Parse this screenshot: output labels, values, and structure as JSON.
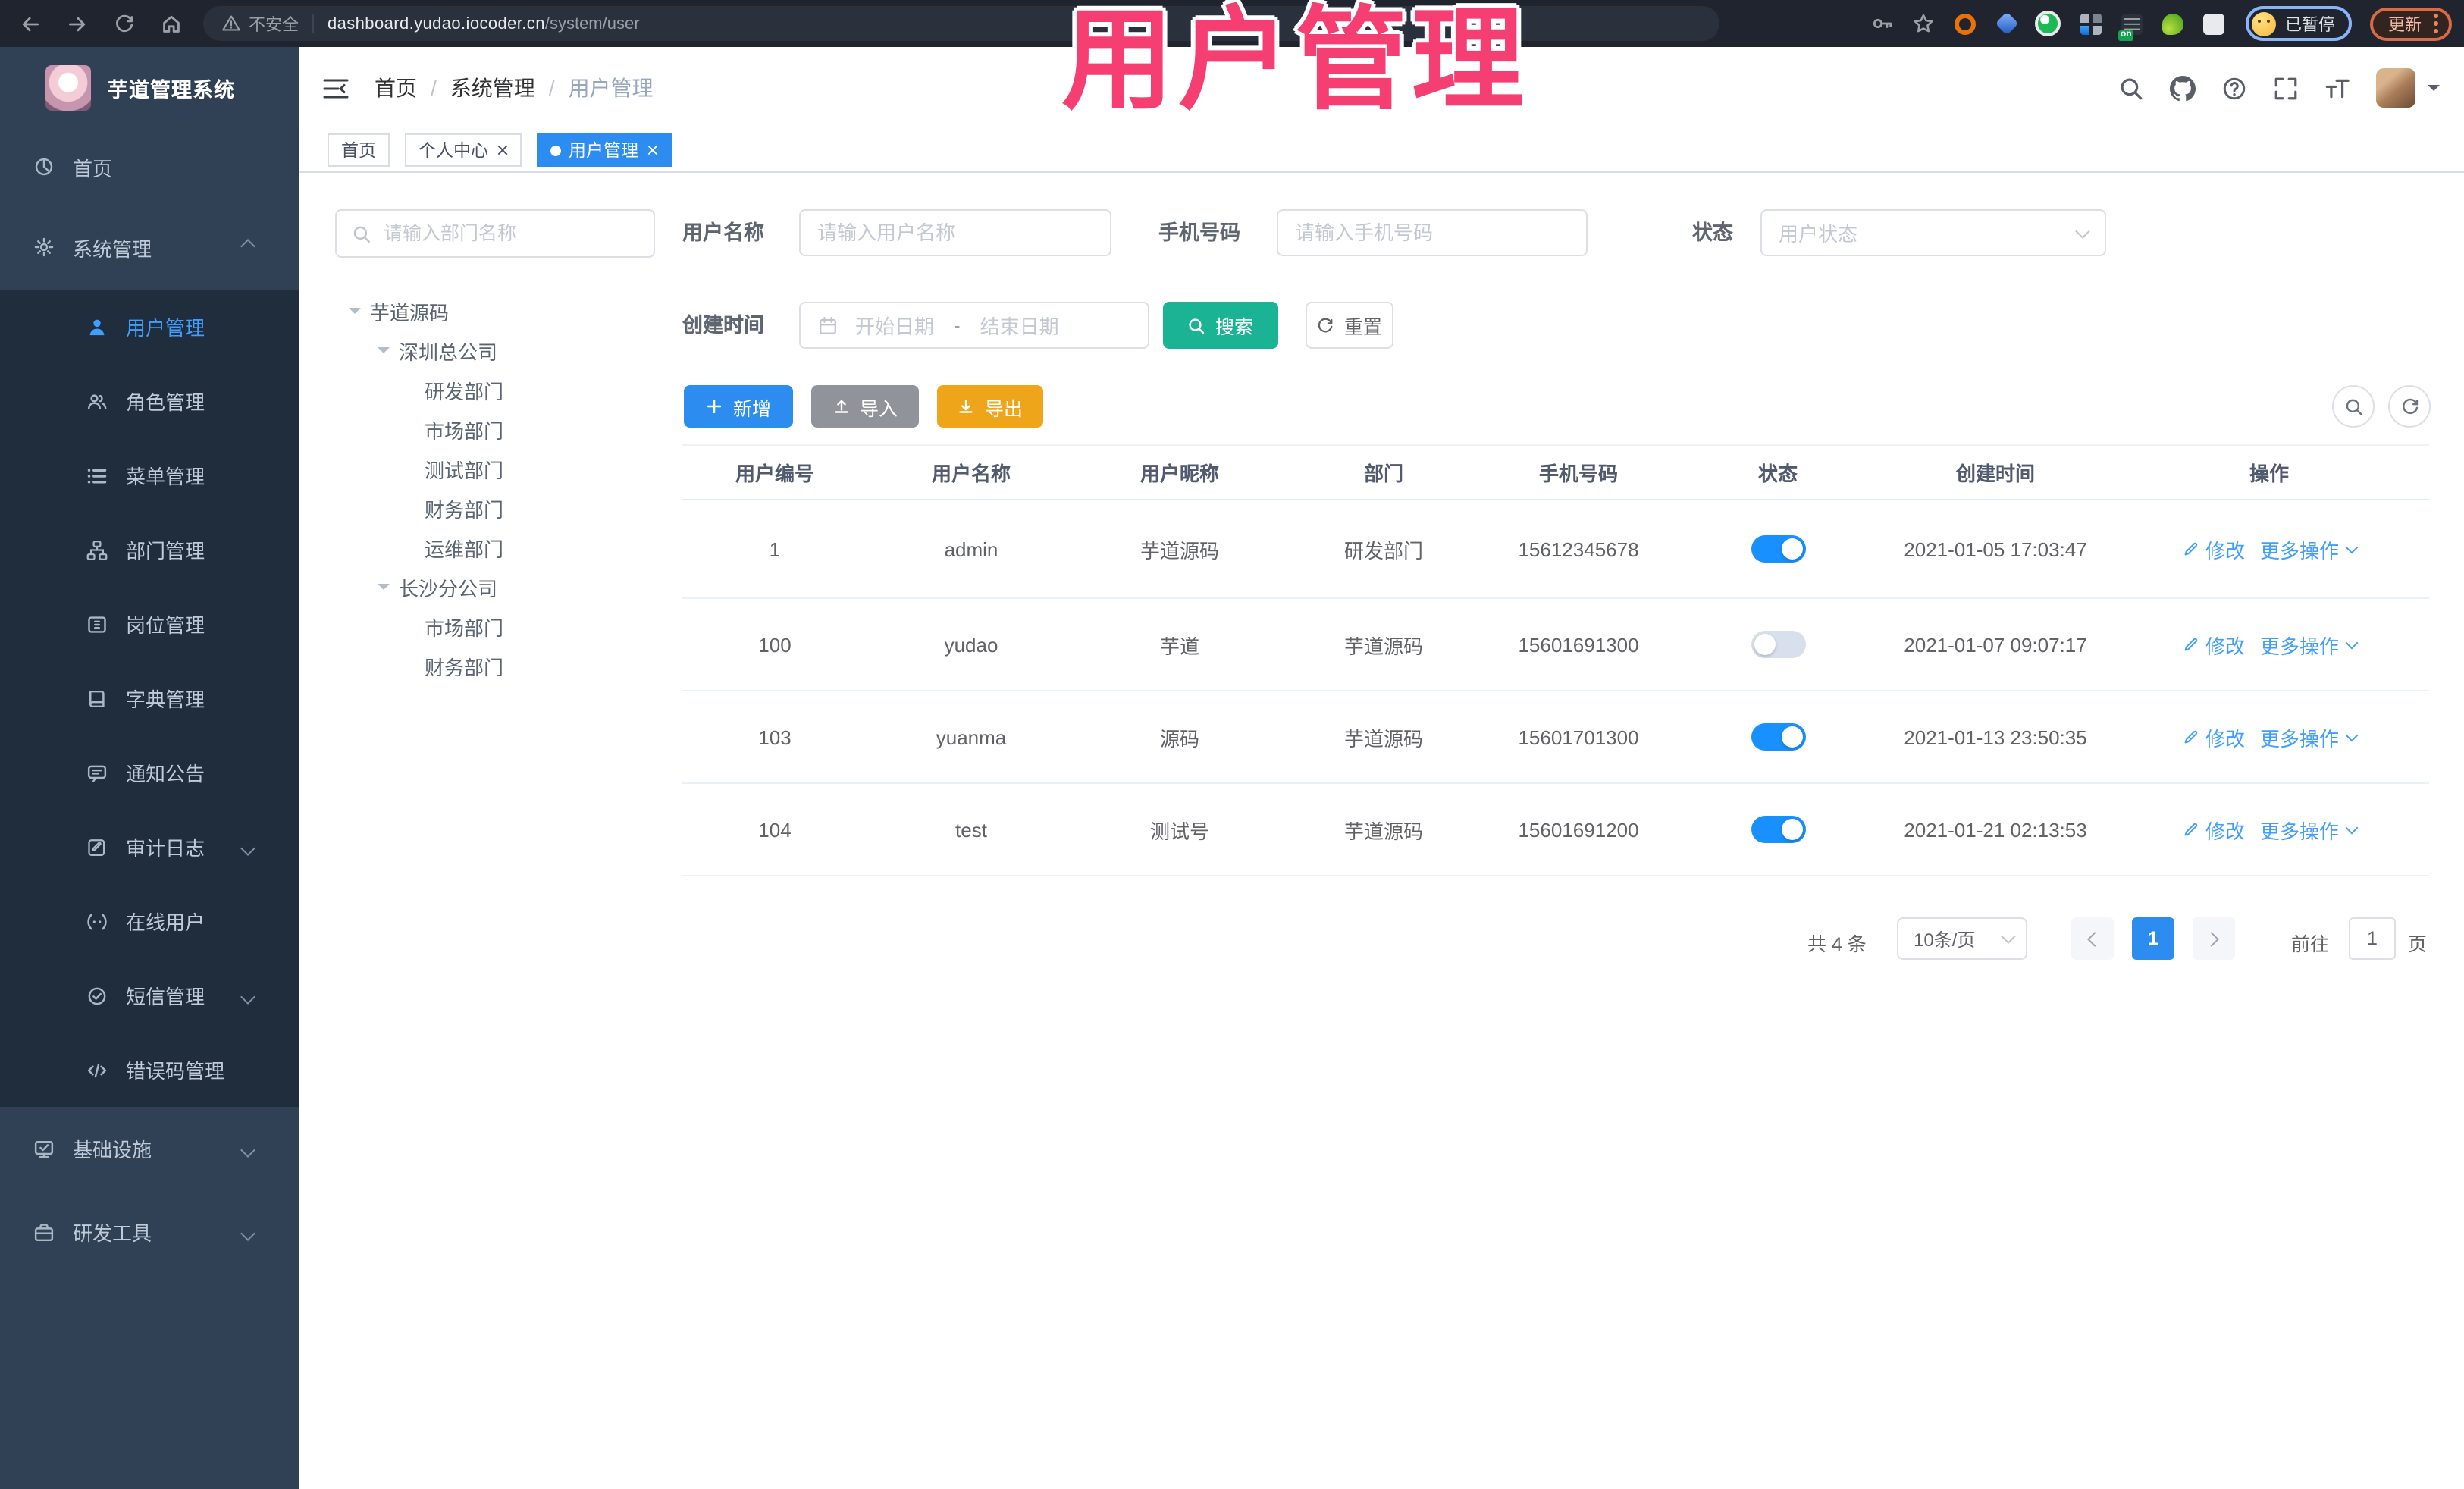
{
  "browser": {
    "security_label": "不安全",
    "url_host": "dashboard.yudao.iocoder.cn",
    "url_path": "/system/user",
    "extension_on_badge": "on",
    "profile_paused_label": "已暂停",
    "update_button_label": "更新"
  },
  "overlay": {
    "watermark": "用户管理"
  },
  "sidebar": {
    "app_title": "芋道管理系统",
    "menu": [
      {
        "label": "首页",
        "icon": "dashboard"
      },
      {
        "label": "系统管理",
        "icon": "gear"
      },
      {
        "label": "用户管理",
        "icon": "user"
      },
      {
        "label": "角色管理",
        "icon": "users"
      },
      {
        "label": "菜单管理",
        "icon": "menu-list"
      },
      {
        "label": "部门管理",
        "icon": "org-tree"
      },
      {
        "label": "岗位管理",
        "icon": "badge"
      },
      {
        "label": "字典管理",
        "icon": "dictionary"
      },
      {
        "label": "通知公告",
        "icon": "announcement"
      },
      {
        "label": "审计日志",
        "icon": "audit-log"
      },
      {
        "label": "在线用户",
        "icon": "online-users"
      },
      {
        "label": "短信管理",
        "icon": "sms"
      },
      {
        "label": "错误码管理",
        "icon": "error-code"
      },
      {
        "label": "基础设施",
        "icon": "infrastructure"
      },
      {
        "label": "研发工具",
        "icon": "dev-tools"
      }
    ]
  },
  "header": {
    "breadcrumb": [
      "首页",
      "系统管理",
      "用户管理"
    ]
  },
  "tags": [
    {
      "label": "首页"
    },
    {
      "label": "个人中心"
    },
    {
      "label": "用户管理"
    }
  ],
  "tree": {
    "search_placeholder": "请输入部门名称",
    "items": [
      {
        "label": "芋道源码",
        "level": 0
      },
      {
        "label": "深圳总公司",
        "level": 1
      },
      {
        "label": "研发部门",
        "level": 2
      },
      {
        "label": "市场部门",
        "level": 2
      },
      {
        "label": "测试部门",
        "level": 2
      },
      {
        "label": "财务部门",
        "level": 2
      },
      {
        "label": "运维部门",
        "level": 2
      },
      {
        "label": "长沙分公司",
        "level": 1
      },
      {
        "label": "市场部门",
        "level": 2
      },
      {
        "label": "财务部门",
        "level": 2
      }
    ]
  },
  "filters": {
    "username_label": "用户名称",
    "username_placeholder": "请输入用户名称",
    "mobile_label": "手机号码",
    "mobile_placeholder": "请输入手机号码",
    "status_label": "状态",
    "status_placeholder": "用户状态",
    "created_label": "创建时间",
    "date_start_placeholder": "开始日期",
    "date_separator": "-",
    "date_end_placeholder": "结束日期",
    "search_button": "搜索",
    "reset_button": "重置"
  },
  "toolbar": {
    "add_label": "新增",
    "import_label": "导入",
    "export_label": "导出"
  },
  "table": {
    "columns": [
      "用户编号",
      "用户名称",
      "用户昵称",
      "部门",
      "手机号码",
      "状态",
      "创建时间",
      "操作"
    ],
    "edit_label": "修改",
    "more_label": "更多操作",
    "rows": [
      {
        "id": "1",
        "username": "admin",
        "nickname": "芋道源码",
        "dept": "研发部门",
        "mobile": "15612345678",
        "status_on": true,
        "created": "2021-01-05 17:03:47"
      },
      {
        "id": "100",
        "username": "yudao",
        "nickname": "芋道",
        "dept": "芋道源码",
        "mobile": "15601691300",
        "status_on": false,
        "created": "2021-01-07 09:07:17"
      },
      {
        "id": "103",
        "username": "yuanma",
        "nickname": "源码",
        "dept": "芋道源码",
        "mobile": "15601701300",
        "status_on": true,
        "created": "2021-01-13 23:50:35"
      },
      {
        "id": "104",
        "username": "test",
        "nickname": "测试号",
        "dept": "芋道源码",
        "mobile": "15601691200",
        "status_on": true,
        "created": "2021-01-21 02:13:53"
      }
    ]
  },
  "pagination": {
    "total_label": "共 4 条",
    "page_size_label": "10条/页",
    "current_page": "1",
    "goto_label": "前往",
    "goto_value": "1",
    "page_unit": "页"
  },
  "colors": {
    "accent_blue": "#2d8cf0",
    "link_blue": "#409eff",
    "teal": "#1ab394",
    "warning_gold": "#efa51a",
    "neutral_gray": "#909399",
    "sidebar_bg": "#304156",
    "submenu_bg": "#1f2d3d",
    "watermark_pink": "#f53e72"
  }
}
